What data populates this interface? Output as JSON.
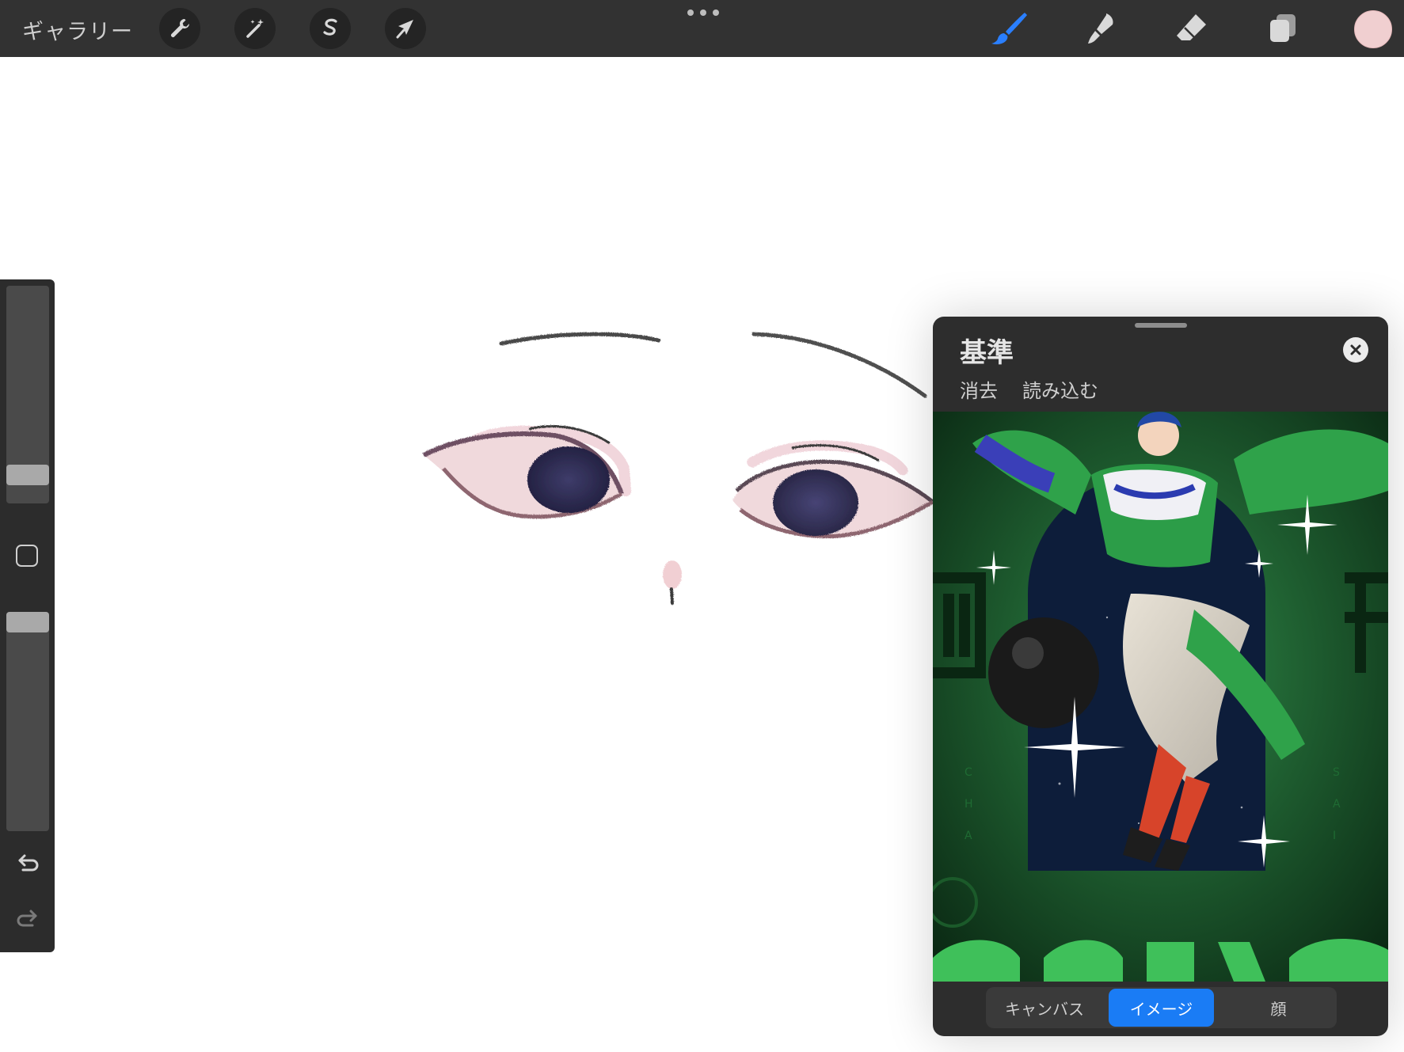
{
  "toolbar": {
    "gallery_label": "ギャラリー",
    "left_tools": [
      {
        "icon": "wrench-icon",
        "name": "actions"
      },
      {
        "icon": "magic-wand-icon",
        "name": "adjustments"
      },
      {
        "icon": "selection-s-icon",
        "name": "selection"
      },
      {
        "icon": "arrow-cursor-icon",
        "name": "transform"
      }
    ],
    "right_tools": [
      {
        "icon": "brush-icon",
        "name": "paint",
        "active_color": "#2a7fff"
      },
      {
        "icon": "smudge-icon",
        "name": "smudge"
      },
      {
        "icon": "eraser-icon",
        "name": "erase"
      },
      {
        "icon": "layers-icon",
        "name": "layers"
      }
    ],
    "current_color": "#f0cfd0"
  },
  "sidebar": {
    "brush_size_level": 0.1,
    "opacity_level": 1.0
  },
  "reference": {
    "title": "基準",
    "actions": [
      "消去",
      "読み込む"
    ],
    "tabs": [
      {
        "label": "キャンバス",
        "active": false
      },
      {
        "label": "イメージ",
        "active": true
      },
      {
        "label": "顔",
        "active": false
      }
    ],
    "accent_color": "#1a7cf5"
  }
}
